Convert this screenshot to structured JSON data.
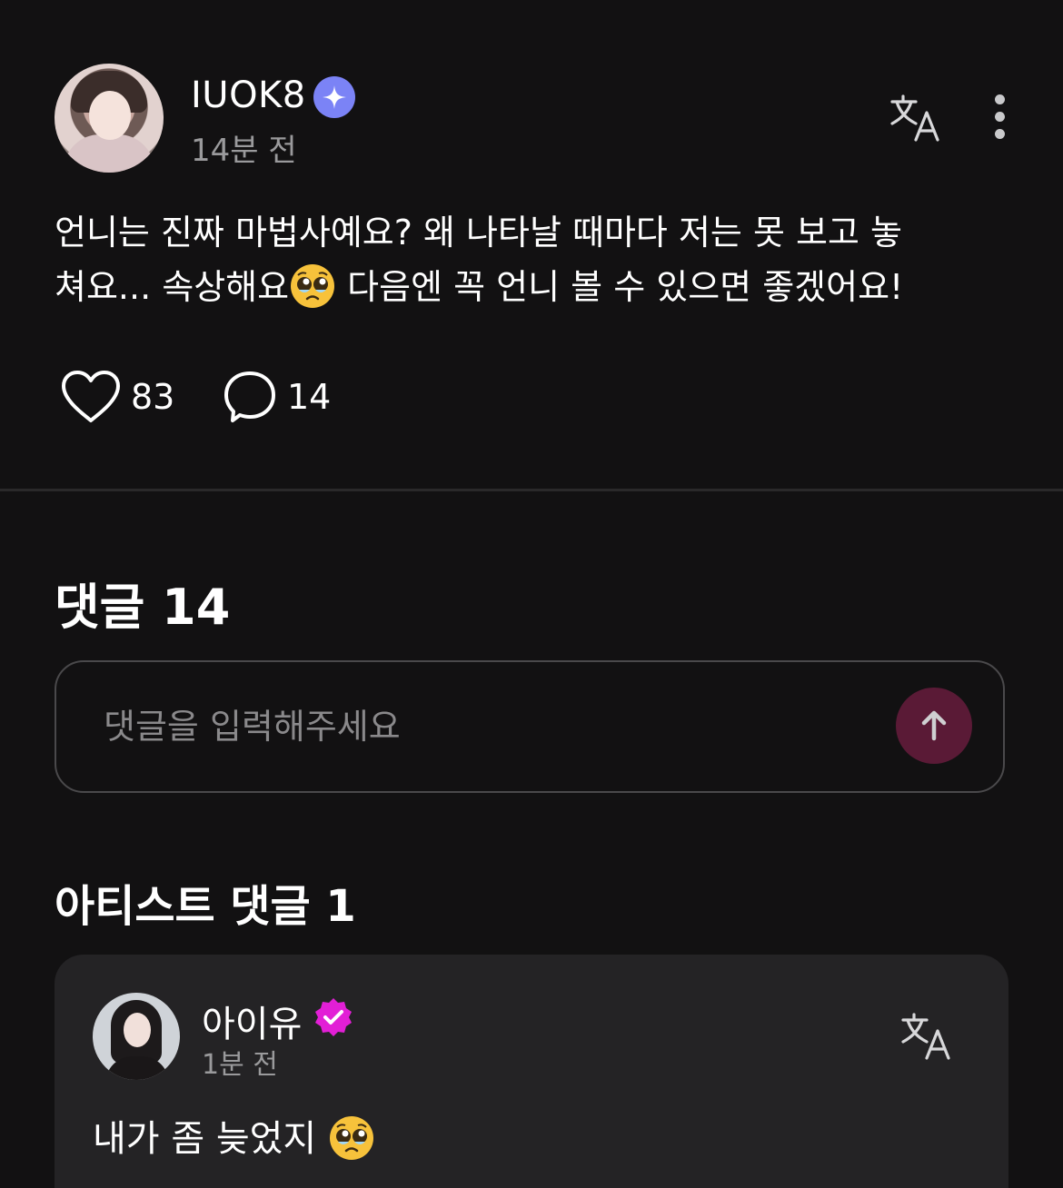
{
  "post": {
    "author": "IUOK8",
    "time": "14분 전",
    "body_line1": "언니는 진짜 마법사예요? 왜 나타날 때마다 저는 못 보고 놓",
    "body_line2a": "쳐요... 속상해요",
    "body_line2b": " 다음엔 꼭 언니 볼 수 있으면 좋겠어요!",
    "likes": "83",
    "comments": "14"
  },
  "comments_section": {
    "title": "댓글 14",
    "input_placeholder": "댓글을 입력해주세요"
  },
  "artist_section": {
    "title": "아티스트 댓글 1",
    "comment": {
      "author": "아이유",
      "time": "1분 전",
      "text": "내가 좀 늦었지 "
    }
  },
  "icons": {
    "verified_star": "sparkle-badge-icon",
    "artist_verified": "verified-check-icon",
    "translate": "translate-icon",
    "more": "more-vertical-icon",
    "like": "heart-icon",
    "comment": "comment-bubble-icon",
    "send": "arrow-up-icon",
    "emoji": "pleading-face-emoji"
  },
  "colors": {
    "background": "#121112",
    "card": "#242325",
    "badge_blue": "#7b83f6",
    "artist_badge": "#e21fd6",
    "send_button": "#5a1a36"
  }
}
